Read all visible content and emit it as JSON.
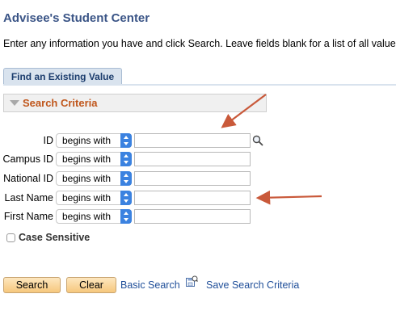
{
  "page": {
    "title": "Advisee's Student Center",
    "instructions": "Enter any information you have and click Search. Leave fields blank for a list of all values."
  },
  "tabs": [
    {
      "label": "Find an Existing Value",
      "active": true
    }
  ],
  "search_criteria": {
    "header": "Search Criteria",
    "fields": [
      {
        "label": "ID",
        "operator": "begins with",
        "value": "",
        "has_lookup": true
      },
      {
        "label": "Campus ID",
        "operator": "begins with",
        "value": ""
      },
      {
        "label": "National ID",
        "operator": "begins with",
        "value": ""
      },
      {
        "label": "Last Name",
        "operator": "begins with",
        "value": ""
      },
      {
        "label": "First Name",
        "operator": "begins with",
        "value": ""
      }
    ],
    "case_sensitive": {
      "label": "Case Sensitive",
      "checked": false
    }
  },
  "actions": {
    "search_label": "Search",
    "clear_label": "Clear",
    "basic_search_label": "Basic Search",
    "save_search_label": "Save Search Criteria"
  },
  "icons": {
    "lookup": "magnifier-icon",
    "save_search": "save-search-icon",
    "collapse": "collapse-triangle-icon"
  },
  "annotations": {
    "arrow_color": "#c9593a"
  },
  "colors": {
    "title": "#3a5486",
    "criteria_header": "#c0561b",
    "link": "#1f4e99",
    "button_top": "#fde7bf",
    "button_bottom": "#f6c77d",
    "spinner": "#3b82e0"
  }
}
